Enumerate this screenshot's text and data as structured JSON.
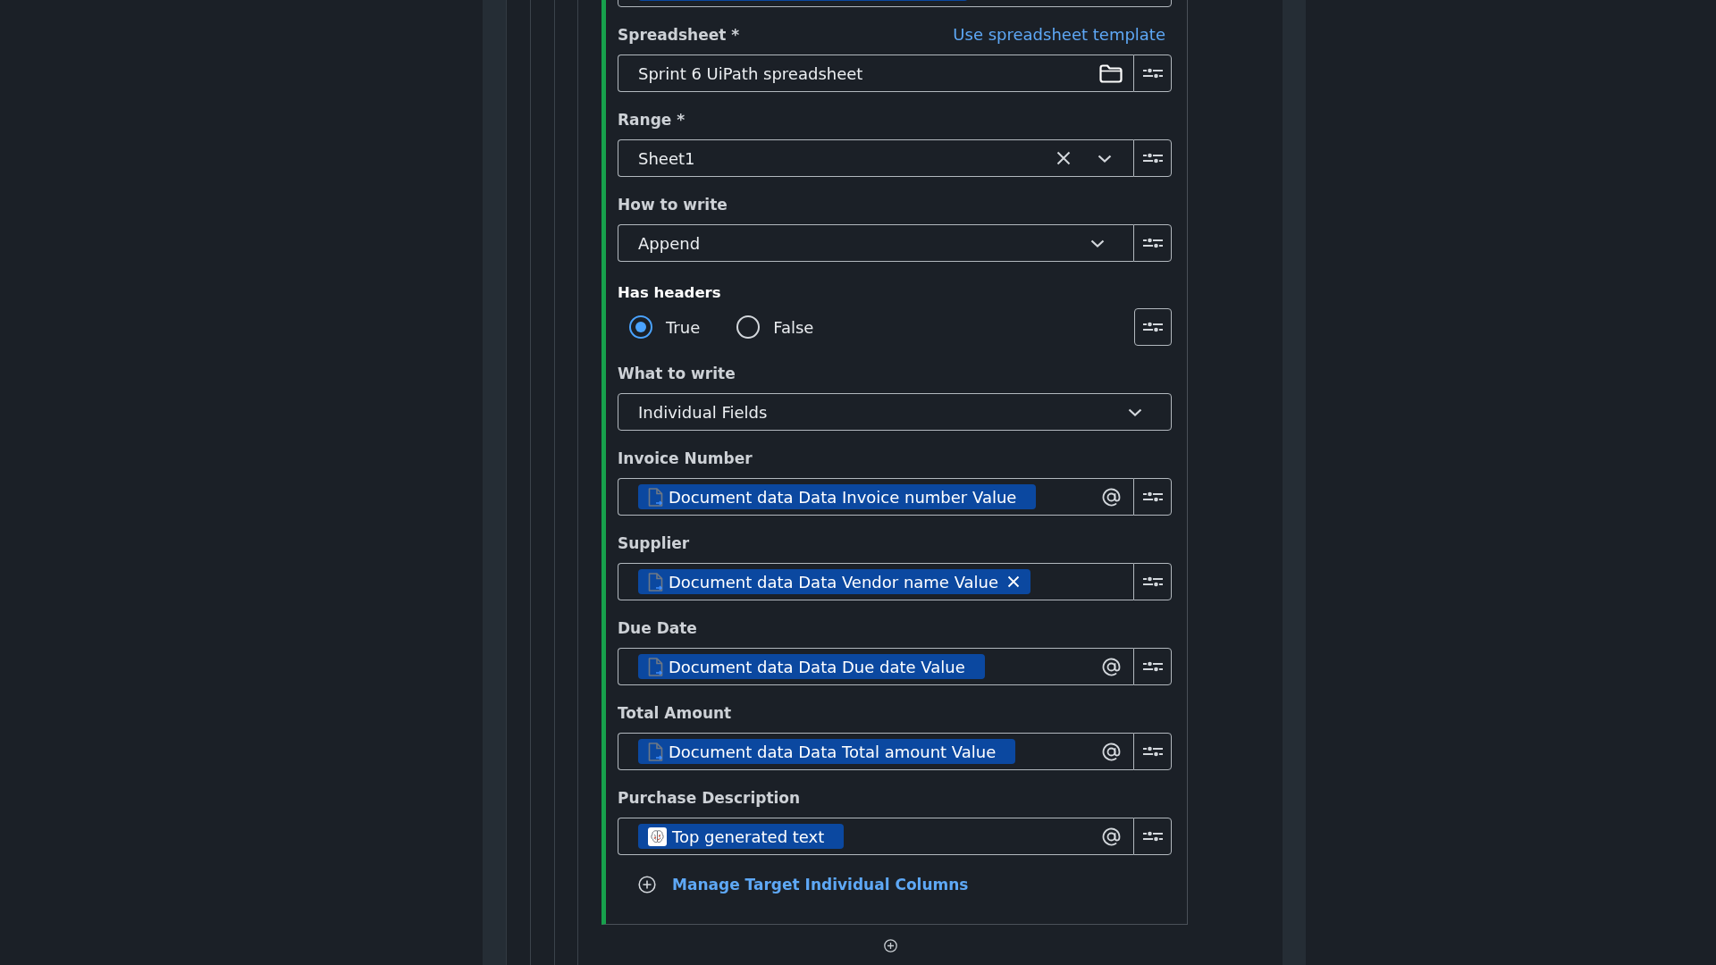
{
  "partial_field": {
    "has_chip": true
  },
  "fields": [
    {
      "kind": "file",
      "label": "Spreadsheet *",
      "link": "Use spreadsheet template",
      "value": "Sprint 6 UiPath spreadsheet",
      "settings": true
    },
    {
      "kind": "dropdown",
      "label": "Range *",
      "value": "Sheet1",
      "clearable": true,
      "settings": true
    },
    {
      "kind": "dropdown",
      "label": "How to write",
      "value": "Append",
      "clearable": false,
      "settings": true
    },
    {
      "kind": "radio",
      "label": "Has headers",
      "options": [
        {
          "label": "True",
          "selected": true
        },
        {
          "label": "False",
          "selected": false
        }
      ],
      "settings": true
    },
    {
      "kind": "dropdown",
      "label": "What to write",
      "value": "Individual Fields",
      "clearable": false,
      "settings": false
    },
    {
      "kind": "token",
      "label": "Invoice Number",
      "token": {
        "kind": "document",
        "text": "Document data Data Invoice number Value",
        "removable": false
      },
      "mention": true,
      "settings": true
    },
    {
      "kind": "token",
      "label": "Supplier",
      "token": {
        "kind": "document",
        "text": "Document data Data Vendor name Value",
        "removable": true
      },
      "mention": false,
      "settings": true
    },
    {
      "kind": "token",
      "label": "Due Date",
      "token": {
        "kind": "document",
        "text": "Document data Data Due date Value",
        "removable": false
      },
      "mention": true,
      "settings": true
    },
    {
      "kind": "token",
      "label": "Total Amount",
      "token": {
        "kind": "document",
        "text": "Document data Data Total amount Value",
        "removable": false
      },
      "mention": true,
      "settings": true
    },
    {
      "kind": "token",
      "label": "Purchase Description",
      "token": {
        "kind": "generated",
        "text": "Top generated text",
        "removable": false
      },
      "mention": true,
      "settings": true
    }
  ],
  "manage_link": "Manage Target Individual Columns"
}
